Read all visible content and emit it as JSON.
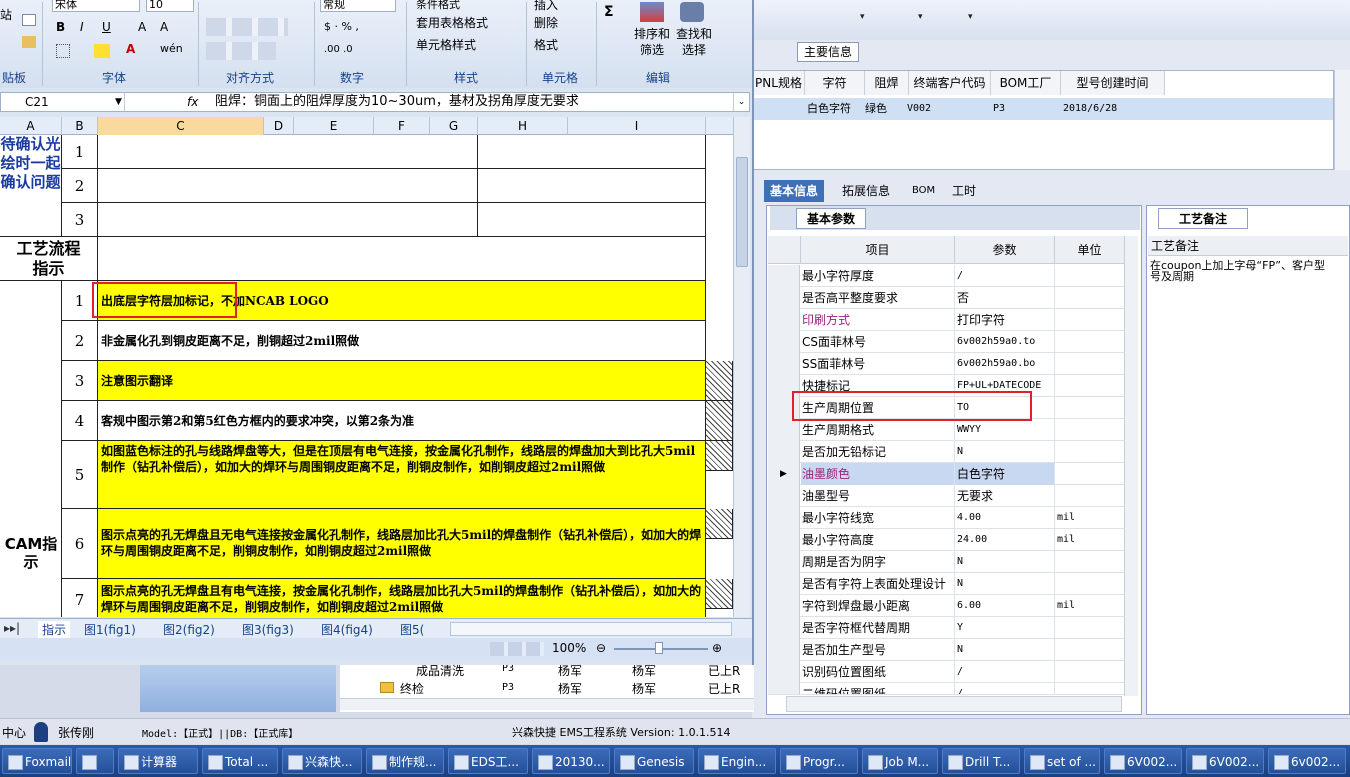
{
  "right_app": {
    "main_info_tab": "主要信息",
    "upper_grid": {
      "headers": [
        "PNL规格",
        "字符",
        "阻焊",
        "终端客户代码",
        "BOM工厂",
        "型号创建时间"
      ],
      "row": [
        "",
        "白色字符",
        "绿色",
        "V002",
        "P3",
        "2018/6/28"
      ]
    },
    "bottom_tabs": [
      "基本信息",
      "拓展信息",
      "BOM",
      "工时"
    ],
    "basic_params_tab": "基本参数",
    "columns": [
      "项目",
      "参数",
      "单位"
    ],
    "params": [
      {
        "item": "最小字符厚度",
        "value": "/",
        "unit": ""
      },
      {
        "item": "是否高平整度要求",
        "value": "否",
        "unit": ""
      },
      {
        "item": "印刷方式",
        "value": "打印字符",
        "unit": ""
      },
      {
        "item": "CS面菲林号",
        "value": "6v002h59a0.to",
        "unit": ""
      },
      {
        "item": "SS面菲林号",
        "value": "6v002h59a0.bo",
        "unit": ""
      },
      {
        "item": "快捷标记",
        "value": "FP+UL+DATECODE",
        "unit": ""
      },
      {
        "item": "生产周期位置",
        "value": "TO",
        "unit": ""
      },
      {
        "item": "生产周期格式",
        "value": "WWYY",
        "unit": ""
      },
      {
        "item": "是否加无铅标记",
        "value": "N",
        "unit": ""
      },
      {
        "item": "油墨颜色",
        "value": "白色字符",
        "unit": ""
      },
      {
        "item": "油墨型号",
        "value": "无要求",
        "unit": ""
      },
      {
        "item": "最小字符线宽",
        "value": "4.00",
        "unit": "mil"
      },
      {
        "item": "最小字符高度",
        "value": "24.00",
        "unit": "mil"
      },
      {
        "item": "周期是否为阴字",
        "value": "N",
        "unit": ""
      },
      {
        "item": "是否有字符上表面处理设计",
        "value": "N",
        "unit": ""
      },
      {
        "item": "字符到焊盘最小距离",
        "value": "6.00",
        "unit": "mil"
      },
      {
        "item": "是否字符框代替周期",
        "value": "Y",
        "unit": ""
      },
      {
        "item": "是否加生产型号",
        "value": "N",
        "unit": ""
      },
      {
        "item": "识别码位置图纸",
        "value": "/",
        "unit": ""
      },
      {
        "item": "二维码位置图纸",
        "value": "/",
        "unit": ""
      }
    ],
    "process_note_tab": "工艺备注",
    "process_note_header": "工艺备注",
    "process_note_text": "在coupon上加上字母“FP”、客户型号及周期"
  },
  "excel": {
    "ribbon": {
      "font_name": "宋体",
      "font_size": "10",
      "number_format": "常规",
      "groups": [
        "字体",
        "对齐方式",
        "数字",
        "样式",
        "单元格",
        "编辑"
      ],
      "clipboard_label": "贴板",
      "buttons": {
        "table_format": "套用表格格式",
        "cell_style": "单元格样式",
        "conditional": "条件格式",
        "insert": "插入",
        "delete": "删除",
        "format": "格式",
        "sort": "排序和\n筛选",
        "find": "查找和\n选择"
      }
    },
    "name_box": "C21",
    "formula": "阻焊：铜面上的阻焊厚度为10~30um，基材及拐角厚度无要求",
    "col_headers": [
      "A",
      "B",
      "C",
      "D",
      "E",
      "F",
      "G",
      "H",
      "I"
    ],
    "section1_label": "待确认光绘时一起确认问题",
    "section1_rows": [
      "1",
      "2",
      "3"
    ],
    "section2_label": "工艺流程指示",
    "section3_label": "CAM指示",
    "cam_rows": [
      {
        "n": "1",
        "text": "出底层字符层加标记，不加NCAB LOGO",
        "yellow": true
      },
      {
        "n": "2",
        "text": "非金属化孔到铜皮距离不足，削铜超过2mil照做",
        "yellow": false
      },
      {
        "n": "3",
        "text": "注意图示翻译",
        "yellow": true
      },
      {
        "n": "4",
        "text": "客规中图示第2和第5红色方框内的要求冲突，以第2条为准",
        "yellow": false
      },
      {
        "n": "5",
        "text": "如图蓝色标注的孔与线路焊盘等大，但是在顶层有电气连接，按金属化孔制作，线路层的焊盘加大到比孔大5mil制作（钻孔补偿后），如加大的焊环与周围铜皮距离不足，削铜皮制作，如削铜皮超过2mil照做",
        "yellow": true
      },
      {
        "n": "6",
        "text": "图示点亮的孔无焊盘且无电气连接按金属化孔制作，线路层加比孔大5mil的焊盘制作（钻孔补偿后），如加大的焊环与周围铜皮距离不足，削铜皮制作，如削铜皮超过2mil照做",
        "yellow": true
      },
      {
        "n": "7",
        "text": "图示点亮的孔无焊盘且有电气连接，按金属化孔制作，线路层加比孔大5mil的焊盘制作（钻孔补偿后），如加大的焊环与周围铜皮距离不足，削铜皮制作，如削铜皮超过2mil照做",
        "yellow": true
      }
    ],
    "sheet_tabs": [
      "指示",
      "图1(fig1)",
      "图2(fig2)",
      "图3(fig3)",
      "图4(fig4)",
      "图5("
    ],
    "zoom": "100%"
  },
  "behind": {
    "rows": [
      {
        "name": "成品清洗",
        "f": "P3",
        "a": "杨军",
        "b": "杨军",
        "c": "已上R"
      },
      {
        "name": "终检",
        "f": "P3",
        "a": "杨军",
        "b": "杨军",
        "c": "已上R"
      }
    ]
  },
  "status": {
    "center": "中心",
    "user": "张传刚",
    "model": "Model:【正式】||DB:【正式库】",
    "system": "兴森快捷 EMS工程系统 Version: 1.0.1.514"
  },
  "taskbar": [
    "Foxmail",
    "",
    "计算器",
    "Total ...",
    "兴森快...",
    "制作规...",
    "EDS工...",
    "20130...",
    "Genesis",
    "Engin...",
    "Progr...",
    "Job M...",
    "Drill T...",
    "set of ...",
    "6V002...",
    "6V002...",
    "6v002..."
  ]
}
